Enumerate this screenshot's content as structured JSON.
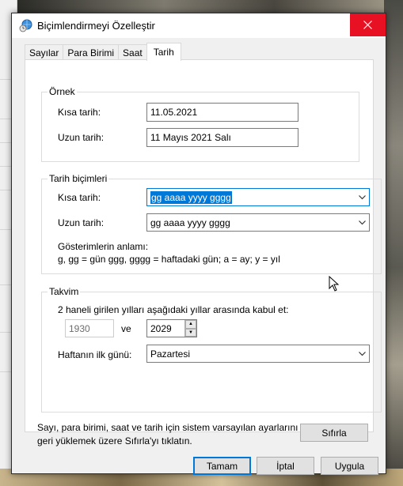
{
  "window": {
    "title": "Biçimlendirmeyi Özelleştir",
    "close_icon": "close-icon"
  },
  "tabs": [
    {
      "label": "Sayılar",
      "active": false
    },
    {
      "label": "Para Birimi",
      "active": false
    },
    {
      "label": "Saat",
      "active": false
    },
    {
      "label": "Tarih",
      "active": true
    }
  ],
  "example": {
    "title": "Örnek",
    "short_label": "Kısa tarih:",
    "short_value": "11.05.2021",
    "long_label": "Uzun tarih:",
    "long_value": "11 Mayıs 2021 Salı"
  },
  "formats": {
    "title": "Tarih biçimleri",
    "short_label": "Kısa tarih:",
    "short_value": "gg aaaa yyyy gggg",
    "long_label": "Uzun tarih:",
    "long_value": "gg aaaa yyyy gggg",
    "meaning_title": "Gösterimlerin anlamı:",
    "meaning_text": "g, gg = gün  ggg, gggg = haftadaki gün;  a = ay;  y = yıl"
  },
  "calendar": {
    "title": "Takvim",
    "two_digit_text": "2 haneli girilen yılları aşağıdaki yıllar arasında kabul et:",
    "year_from": "1930",
    "and_label": "ve",
    "year_to": "2029",
    "first_day_label": "Haftanın ilk günü:",
    "first_day_value": "Pazartesi"
  },
  "footer": {
    "note": "Sayı, para birimi, saat ve tarih için sistem varsayılan ayarlarını geri yüklemek üzere Sıfırla'yı tıklatın.",
    "reset_label": "Sıfırla",
    "ok_label": "Tamam",
    "cancel_label": "İptal",
    "apply_label": "Uygula"
  },
  "colors": {
    "accent": "#0078d7",
    "close": "#e81123"
  }
}
